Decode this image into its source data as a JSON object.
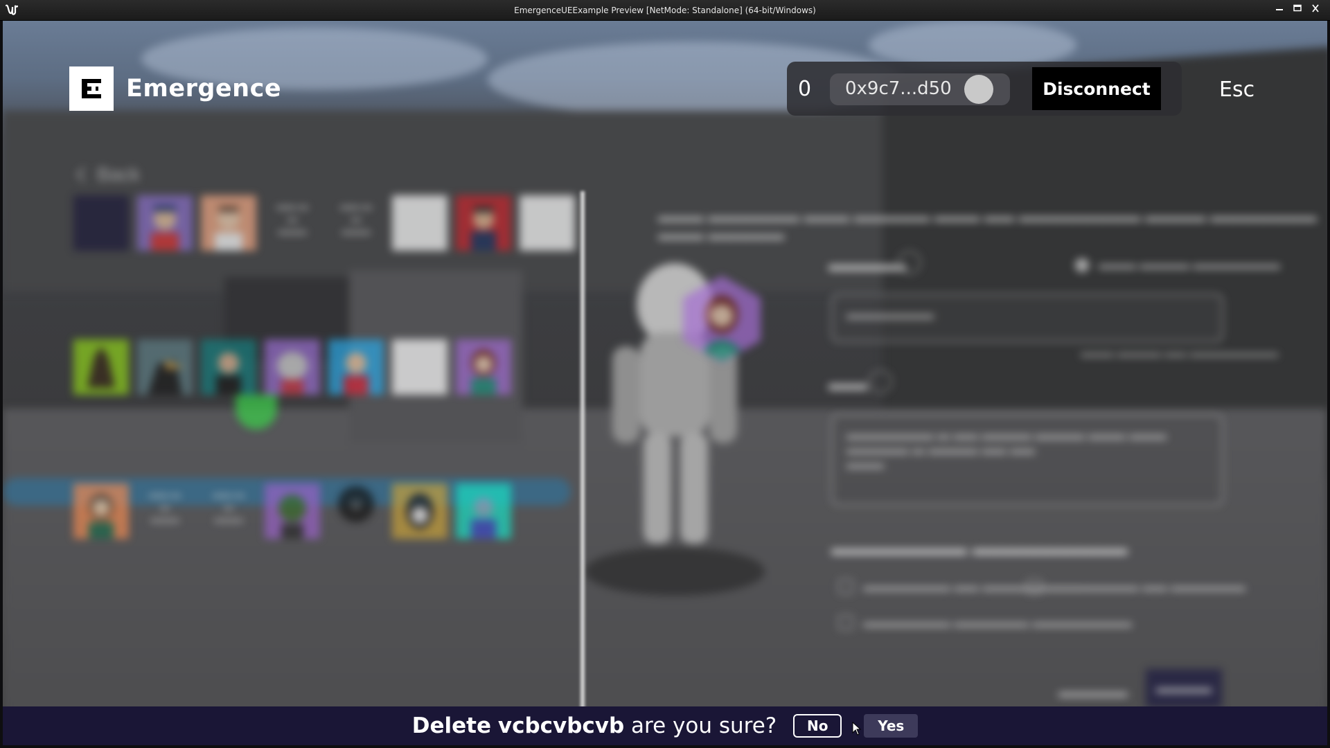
{
  "window": {
    "title": "EmergenceUEExample Preview [NetMode: Standalone]  (64-bit/Windows)",
    "logo_icon": "unreal-engine-icon",
    "controls": [
      "minimize-icon",
      "maximize-icon",
      "close-icon"
    ]
  },
  "header": {
    "brand_name": "Emergence",
    "brand_icon": "emergence-e-logo",
    "balance": "0",
    "wallet_address": "0x9c7...d50",
    "disconnect_label": "Disconnect",
    "esc_label": "Esc"
  },
  "left_panel": {
    "back_label": "Back"
  },
  "confirm": {
    "prefix": "Delete",
    "name": "vcbcvbcvb",
    "suffix": "are you sure?",
    "no_label": "No",
    "yes_label": "Yes"
  },
  "colors": {
    "confirm_bar": "#1a1636",
    "disconnect_bg": "#000000",
    "yes_bg": "#3d3a5a"
  }
}
